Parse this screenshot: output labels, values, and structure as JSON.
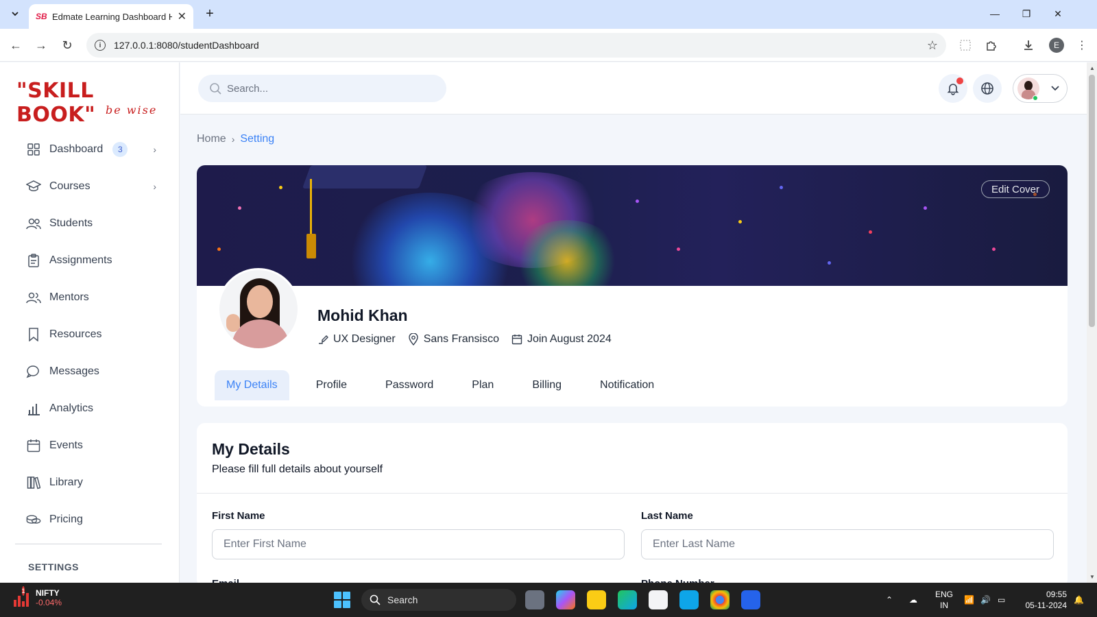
{
  "browser": {
    "tab_title": "Edmate Learning Dashboard HTML",
    "favicon_text": "SB",
    "url": "127.0.0.1:8080/studentDashboard",
    "profile_initial": "E"
  },
  "sidebar": {
    "logo_main": "\"SKILL BOOK\"",
    "logo_sub": "be wise",
    "items": [
      {
        "label": "Dashboard",
        "icon": "grid-icon",
        "badge": "3",
        "has_chevron": true
      },
      {
        "label": "Courses",
        "icon": "graduation-cap-icon",
        "has_chevron": true
      },
      {
        "label": "Students",
        "icon": "users-icon"
      },
      {
        "label": "Assignments",
        "icon": "clipboard-icon"
      },
      {
        "label": "Mentors",
        "icon": "mentors-icon"
      },
      {
        "label": "Resources",
        "icon": "bookmark-icon"
      },
      {
        "label": "Messages",
        "icon": "chat-icon"
      },
      {
        "label": "Analytics",
        "icon": "bar-chart-icon"
      },
      {
        "label": "Events",
        "icon": "calendar-icon"
      },
      {
        "label": "Library",
        "icon": "books-icon"
      },
      {
        "label": "Pricing",
        "icon": "coins-icon"
      }
    ],
    "settings_label": "SETTINGS"
  },
  "header": {
    "search_placeholder": "Search..."
  },
  "breadcrumb": {
    "home": "Home",
    "current": "Setting"
  },
  "profile": {
    "edit_cover_label": "Edit Cover",
    "name": "Mohid Khan",
    "role": "UX Designer",
    "location": "Sans Fransisco",
    "joined": "Join August 2024",
    "tabs": [
      {
        "label": "My Details",
        "active": true
      },
      {
        "label": "Profile",
        "active": false
      },
      {
        "label": "Password",
        "active": false
      },
      {
        "label": "Plan",
        "active": false
      },
      {
        "label": "Billing",
        "active": false
      },
      {
        "label": "Notification",
        "active": false
      }
    ]
  },
  "details": {
    "title": "My Details",
    "subtitle": "Please fill full details about yourself",
    "first_name_label": "First Name",
    "first_name_placeholder": "Enter First Name",
    "first_name_value": "",
    "last_name_label": "Last Name",
    "last_name_placeholder": "Enter Last Name",
    "last_name_value": "",
    "next_left_label": "Email",
    "next_right_label": "Phone Number"
  },
  "taskbar": {
    "stock_name": "NIFTY",
    "stock_change": "-0.04%",
    "stock_badge": "1",
    "search_label": "Search",
    "lang_line1": "ENG",
    "lang_line2": "IN",
    "time": "09:55",
    "date": "05-11-2024"
  },
  "colors": {
    "accent": "#3b82f6",
    "logo_red": "#c81e1e",
    "active_tab_bg": "#e8effb",
    "notification_dot": "#ef4444"
  }
}
